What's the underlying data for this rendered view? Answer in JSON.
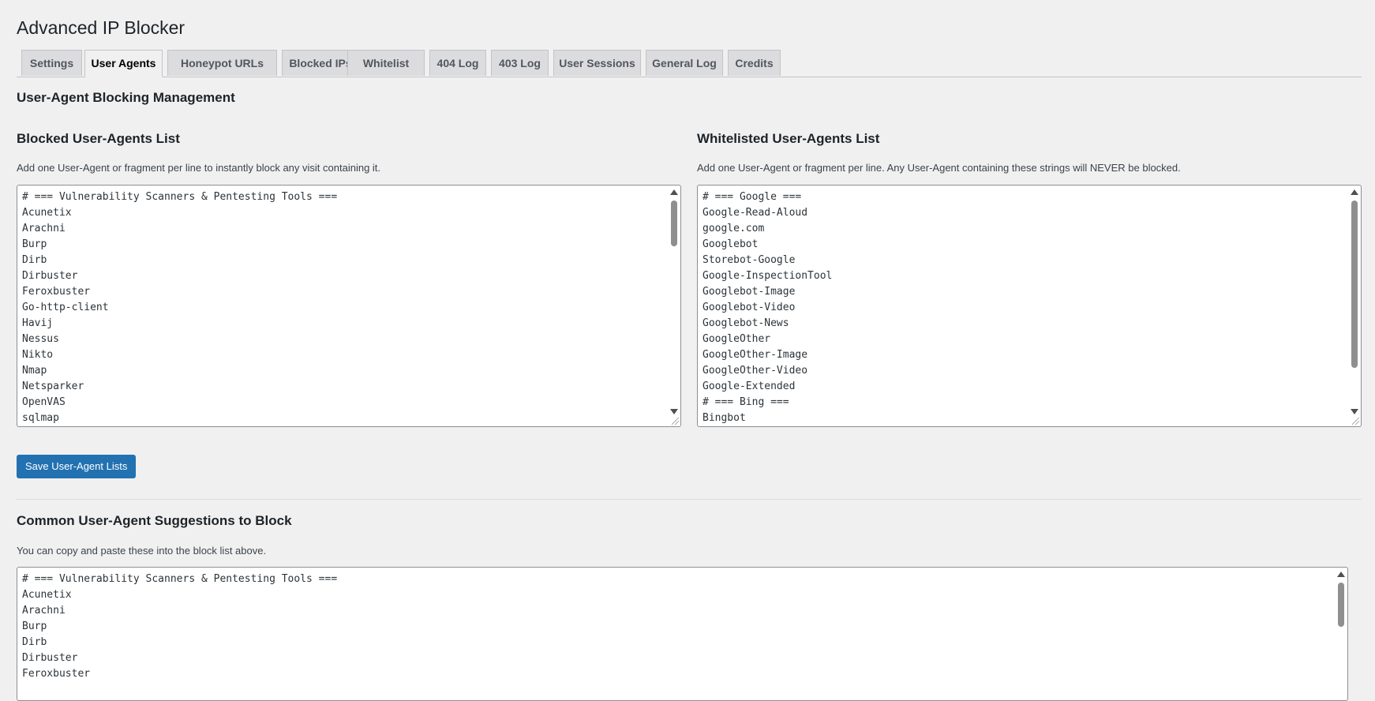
{
  "page": {
    "title": "Advanced IP Blocker"
  },
  "tabs": [
    {
      "label": "Settings",
      "active": false
    },
    {
      "label": "User Agents",
      "active": true
    },
    {
      "label": "Honeypot URLs",
      "active": false
    },
    {
      "label": "Blocked IPs",
      "active": false
    },
    {
      "label": "Whitelist",
      "active": false
    },
    {
      "label": "404 Log",
      "active": false
    },
    {
      "label": "403 Log",
      "active": false
    },
    {
      "label": "User Sessions",
      "active": false
    },
    {
      "label": "General Log",
      "active": false
    },
    {
      "label": "Credits",
      "active": false
    }
  ],
  "section_title": "User-Agent Blocking Management",
  "blocked": {
    "title": "Blocked User-Agents List",
    "description": "Add one User-Agent or fragment per line to instantly block any visit containing it.",
    "lines": [
      "# === Vulnerability Scanners & Pentesting Tools ===",
      "Acunetix",
      "Arachni",
      "Burp",
      "Dirb",
      "Dirbuster",
      "Feroxbuster",
      "Go-http-client",
      "Havij",
      "Nessus",
      "Nikto",
      "Nmap",
      "Netsparker",
      "OpenVAS",
      "sqlmap"
    ]
  },
  "whitelisted": {
    "title": "Whitelisted User-Agents List",
    "description": "Add one User-Agent or fragment per line. Any User-Agent containing these strings will NEVER be blocked.",
    "lines": [
      "# === Google ===",
      "Google-Read-Aloud",
      "google.com",
      "Googlebot",
      "Storebot-Google",
      "Google-InspectionTool",
      "Googlebot-Image",
      "Googlebot-Video",
      "Googlebot-News",
      "GoogleOther",
      "GoogleOther-Image",
      "GoogleOther-Video",
      "Google-Extended",
      "# === Bing ===",
      "Bingbot"
    ]
  },
  "save_button": "Save User-Agent Lists",
  "suggestions": {
    "title": "Common User-Agent Suggestions to Block",
    "description": "You can copy and paste these into the block list above.",
    "lines": [
      "# === Vulnerability Scanners & Pentesting Tools ===",
      "Acunetix",
      "Arachni",
      "Burp",
      "Dirb",
      "Dirbuster",
      "Feroxbuster"
    ]
  },
  "colors": {
    "accent": "#2271b1",
    "background": "#f0f0f1"
  }
}
